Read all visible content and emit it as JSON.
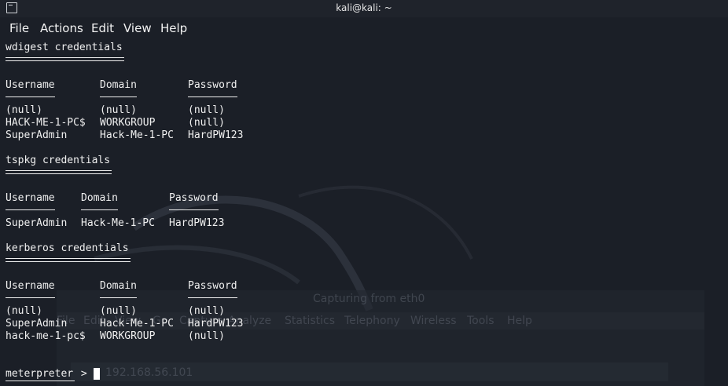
{
  "window": {
    "title": "kali@kali: ~"
  },
  "menu": [
    "File",
    "Actions",
    "Edit",
    "View",
    "Help"
  ],
  "sections": [
    {
      "title": "wdigest credentials",
      "headers": [
        "Username",
        "Domain",
        "Password"
      ],
      "rows": [
        [
          "(null)",
          "(null)",
          "(null)"
        ],
        [
          "HACK-ME-1-PC$",
          "WORKGROUP",
          "(null)"
        ],
        [
          "SuperAdmin",
          "Hack-Me-1-PC",
          "HardPW123"
        ]
      ]
    },
    {
      "title": "tspkg credentials",
      "headers": [
        "Username",
        "Domain",
        "Password"
      ],
      "rows": [
        [
          "SuperAdmin",
          "Hack-Me-1-PC",
          "HardPW123"
        ]
      ]
    },
    {
      "title": "kerberos credentials",
      "headers": [
        "Username",
        "Domain",
        "Password"
      ],
      "rows": [
        [
          "(null)",
          "(null)",
          "(null)"
        ],
        [
          "SuperAdmin",
          "Hack-Me-1-PC",
          "HardPW123"
        ],
        [
          "hack-me-1-pc$",
          "WORKGROUP",
          "(null)"
        ]
      ]
    }
  ],
  "prompt": {
    "text": "meterpreter",
    "suffix": " > "
  },
  "background_window": {
    "title": "Capturing from eth0",
    "menu": [
      "File",
      "Edit",
      "View",
      "Go",
      "Capture",
      "Analyze",
      "Statistics",
      "Telephony",
      "Wireless",
      "Tools",
      "Help"
    ],
    "filter_text": "192.168.56.101"
  }
}
